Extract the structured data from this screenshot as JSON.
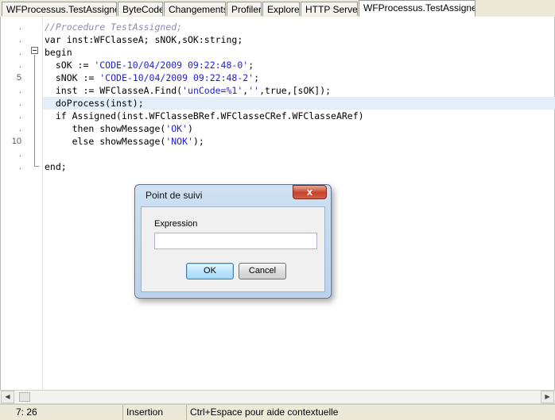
{
  "tabs": [
    {
      "label": "WFProcessus.TestAssigned",
      "active": false
    },
    {
      "label": "ByteCode",
      "active": false
    },
    {
      "label": "Changements",
      "active": false
    },
    {
      "label": "Profiler",
      "active": false
    },
    {
      "label": "Explorer",
      "active": false
    },
    {
      "label": "HTTP Server",
      "active": false
    },
    {
      "label": "WFProcessus.TestAssigned",
      "active": true
    }
  ],
  "editor": {
    "line_numbers": [
      ".",
      ".",
      ".",
      ".",
      "5",
      ".",
      ".",
      ".",
      ".",
      "10",
      ".",
      "."
    ],
    "highlighted_line": 6,
    "lines": [
      {
        "segments": [
          {
            "t": "//Procedure TestAssigned;",
            "c": "comment"
          }
        ]
      },
      {
        "segments": [
          {
            "t": "var inst:WFClasseA; sNOK,sOK:string;",
            "c": "plain"
          }
        ]
      },
      {
        "segments": [
          {
            "t": "begin",
            "c": "plain"
          }
        ]
      },
      {
        "segments": [
          {
            "t": "  sOK := ",
            "c": "plain"
          },
          {
            "t": "'CODE-10/04/2009 09:22:48-0'",
            "c": "string"
          },
          {
            "t": ";",
            "c": "plain"
          }
        ]
      },
      {
        "segments": [
          {
            "t": "  sNOK := ",
            "c": "plain"
          },
          {
            "t": "'CODE-10/04/2009 09:22:48-2'",
            "c": "string"
          },
          {
            "t": ";",
            "c": "plain"
          }
        ]
      },
      {
        "segments": [
          {
            "t": "  inst := WFClasseA.Find(",
            "c": "plain"
          },
          {
            "t": "'unCode=%1'",
            "c": "string"
          },
          {
            "t": ",",
            "c": "plain"
          },
          {
            "t": "''",
            "c": "string"
          },
          {
            "t": ",true,[sOK]);",
            "c": "plain"
          }
        ]
      },
      {
        "segments": [
          {
            "t": "  doProcess(inst);",
            "c": "plain"
          }
        ]
      },
      {
        "segments": [
          {
            "t": "  if Assigned(inst.WFClasseBRef.WFClasseCRef.WFClasseARef)",
            "c": "plain"
          }
        ]
      },
      {
        "segments": [
          {
            "t": "     then showMessage(",
            "c": "plain"
          },
          {
            "t": "'OK'",
            "c": "string"
          },
          {
            "t": ")",
            "c": "plain"
          }
        ]
      },
      {
        "segments": [
          {
            "t": "     else showMessage(",
            "c": "plain"
          },
          {
            "t": "'NOK'",
            "c": "string"
          },
          {
            "t": ");",
            "c": "plain"
          }
        ]
      },
      {
        "segments": []
      },
      {
        "segments": [
          {
            "t": "end;",
            "c": "plain"
          }
        ]
      }
    ]
  },
  "dialog": {
    "title": "Point de suivi",
    "close_glyph": "x",
    "field_label": "Expression",
    "field_value": "",
    "ok_label": "OK",
    "cancel_label": "Cancel"
  },
  "statusbar": {
    "position": "7: 26",
    "mode": "Insertion",
    "hint": "Ctrl+Espace pour aide contextuelle"
  },
  "colors": {
    "string": "#1f1fd0",
    "comment": "#8b8bb3",
    "current_line": "#e3eef9"
  },
  "icons": {
    "fold": "fold-collapse-icon",
    "scroll_left": "scroll-left-arrow-icon",
    "scroll_right": "scroll-right-arrow-icon"
  }
}
